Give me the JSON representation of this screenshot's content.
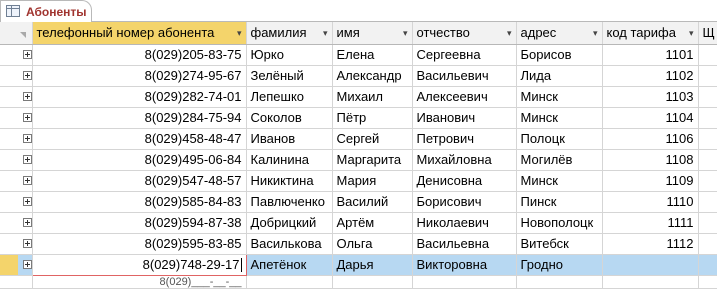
{
  "tab": {
    "label": "Абоненты"
  },
  "columns": [
    {
      "label": "телефонный номер абонента",
      "sort": "▾"
    },
    {
      "label": "фамилия",
      "sort": "▾"
    },
    {
      "label": "имя",
      "sort": "▾"
    },
    {
      "label": "отчество",
      "sort": "▾"
    },
    {
      "label": "адрес",
      "sort": "▾"
    },
    {
      "label": "код тарифа",
      "sort": "▾"
    },
    {
      "label": "Щ",
      "sort": ""
    }
  ],
  "rows": [
    [
      "8(029)205-83-75",
      "Юрко",
      "Елена",
      "Сергеевна",
      "Борисов",
      "1101"
    ],
    [
      "8(029)274-95-67",
      "Зелёный",
      "Александр",
      "Васильевич",
      "Лида",
      "1102"
    ],
    [
      "8(029)282-74-01",
      "Лепешко",
      "Михаил",
      "Алексеевич",
      "Минск",
      "1103"
    ],
    [
      "8(029)284-75-94",
      "Соколов",
      "Пётр",
      "Иванович",
      "Минск",
      "1104"
    ],
    [
      "8(029)458-48-47",
      "Иванов",
      "Сергей",
      "Петрович",
      "Полоцк",
      "1106"
    ],
    [
      "8(029)495-06-84",
      "Калинина",
      "Маргарита",
      "Михайловна",
      "Могилёв",
      "1108"
    ],
    [
      "8(029)547-48-57",
      "Никиктина",
      "Мария",
      "Денисовна",
      "Минск",
      "1109"
    ],
    [
      "8(029)585-84-83",
      "Павлюченко",
      "Василий",
      "Борисович",
      "Пинск",
      "1110"
    ],
    [
      "8(029)594-87-38",
      "Добрицкий",
      "Артём",
      "Николаевич",
      "Новополоцк",
      "1111"
    ],
    [
      "8(029)595-83-85",
      "Василькова",
      "Ольга",
      "Васильевна",
      "Витебск",
      "1112"
    ]
  ],
  "current_row": [
    "8(029)748-29-17",
    "Апетёнок",
    "Дарья",
    "Викторовна",
    "Гродно",
    ""
  ],
  "partial_row": [
    "8(029)___-__-__"
  ]
}
